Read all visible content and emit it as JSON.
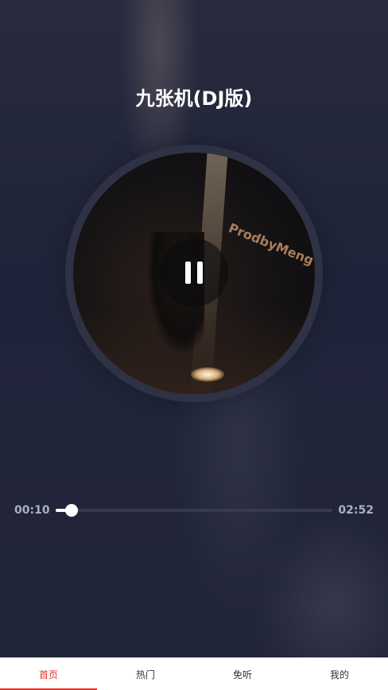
{
  "player": {
    "song_title": "九张机(DJ版)",
    "cover_watermark": "ProdbyMeng",
    "state": "playing",
    "control_icon": "pause-icon",
    "current_time": "00:10",
    "total_time": "02:52",
    "progress_fraction": 0.058
  },
  "tabbar": {
    "active_index": 0,
    "accent_color": "#e0332c",
    "items": [
      {
        "label": "首页"
      },
      {
        "label": "热门"
      },
      {
        "label": "免听"
      },
      {
        "label": "我的"
      }
    ]
  }
}
